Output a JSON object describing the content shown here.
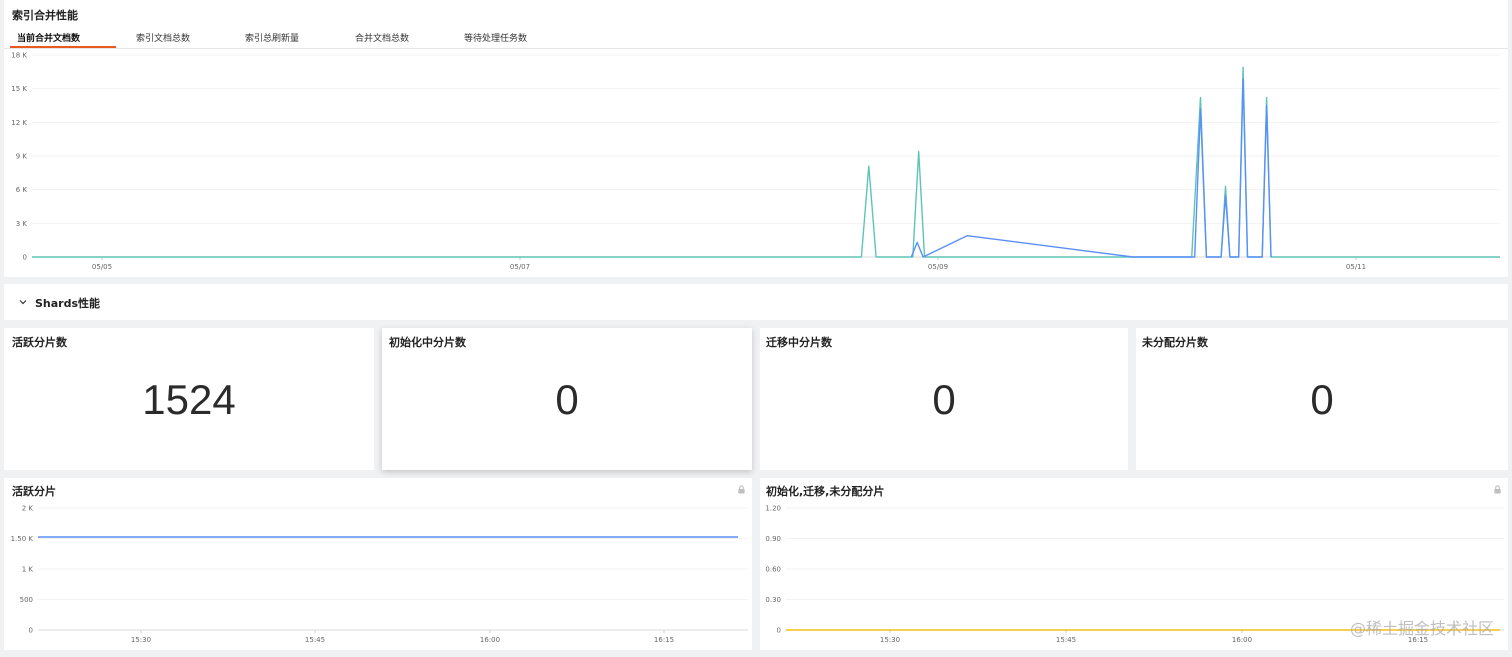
{
  "merge_panel": {
    "title": "索引合并性能",
    "tabs": [
      {
        "label": "当前合并文档数",
        "active": true
      },
      {
        "label": "索引文档总数",
        "active": false
      },
      {
        "label": "索引总刷新量",
        "active": false
      },
      {
        "label": "合并文档总数",
        "active": false
      },
      {
        "label": "等待处理任务数",
        "active": false
      }
    ]
  },
  "shards_section": {
    "title": "Shards性能",
    "collapse_icon": "chevron-down-icon"
  },
  "stats": [
    {
      "title": "活跃分片数",
      "value": "1524"
    },
    {
      "title": "初始化中分片数",
      "value": "0"
    },
    {
      "title": "迁移中分片数",
      "value": "0"
    },
    {
      "title": "未分配分片数",
      "value": "0"
    }
  ],
  "active_shards_panel": {
    "title": "活跃分片",
    "icon": "lock-icon"
  },
  "other_shards_panel": {
    "title": "初始化,迁移,未分配分片",
    "icon": "lock-icon"
  },
  "watermark": "@稀土掘金技术社区",
  "colors": {
    "teal": "#5ec4b6",
    "blue": "#5b8ff9",
    "yellow": "#f6bd16",
    "tab_accent": "#e85a1d"
  },
  "chart_data": [
    {
      "type": "line",
      "ylim": [
        0,
        18000
      ],
      "y_ticks": [
        "0",
        "3 K",
        "6 K",
        "9 K",
        "12 K",
        "15 K",
        "18 K"
      ],
      "x_tick_labels": [
        "05/05",
        "05/07",
        "05/09",
        "05/11"
      ],
      "series": [
        {
          "color": "#5ec4b6",
          "points": [
            [
              0,
              0
            ],
            [
              0.05,
              0
            ],
            [
              0.3,
              0
            ],
            [
              0.55,
              0
            ],
            [
              0.565,
              0
            ],
            [
              0.57,
              8100
            ],
            [
              0.575,
              0
            ],
            [
              0.595,
              0
            ],
            [
              0.6,
              0
            ],
            [
              0.604,
              9400
            ],
            [
              0.608,
              0
            ],
            [
              0.79,
              0
            ],
            [
              0.796,
              14200
            ],
            [
              0.8,
              0
            ],
            [
              0.81,
              0
            ],
            [
              0.813,
              6300
            ],
            [
              0.816,
              0
            ],
            [
              0.822,
              0
            ],
            [
              0.825,
              16900
            ],
            [
              0.828,
              0
            ],
            [
              0.838,
              0
            ],
            [
              0.841,
              14200
            ],
            [
              0.844,
              0
            ],
            [
              1,
              0
            ]
          ]
        },
        {
          "color": "#5b8ff9",
          "points": [
            [
              0.599,
              0
            ],
            [
              0.603,
              1300
            ],
            [
              0.607,
              0
            ],
            [
              0.637,
              1900
            ],
            [
              0.75,
              0
            ],
            [
              0.792,
              0
            ],
            [
              0.796,
              13200
            ],
            [
              0.8,
              0
            ],
            [
              0.81,
              0
            ],
            [
              0.813,
              5500
            ],
            [
              0.816,
              0
            ],
            [
              0.822,
              0
            ],
            [
              0.825,
              15900
            ],
            [
              0.828,
              0
            ],
            [
              0.838,
              0
            ],
            [
              0.841,
              13500
            ],
            [
              0.844,
              0
            ]
          ]
        }
      ]
    },
    {
      "type": "line",
      "ylim": [
        0,
        2000
      ],
      "y_ticks": [
        "0",
        "500",
        "1 K",
        "1.50 K",
        "2 K"
      ],
      "x_tick_labels": [
        "15:30",
        "15:45",
        "16:00",
        "16:15"
      ],
      "series": [
        {
          "color": "#5b8ff9",
          "values": [
            1524,
            1524
          ]
        }
      ]
    },
    {
      "type": "line",
      "ylim": [
        0,
        1.2
      ],
      "y_ticks": [
        "0",
        "0.30",
        "0.60",
        "0.90",
        "1.20"
      ],
      "x_tick_labels": [
        "15:30",
        "15:45",
        "16:00",
        "16:15"
      ],
      "series": [
        {
          "color": "#f6bd16",
          "values": [
            0,
            0
          ]
        }
      ]
    }
  ]
}
